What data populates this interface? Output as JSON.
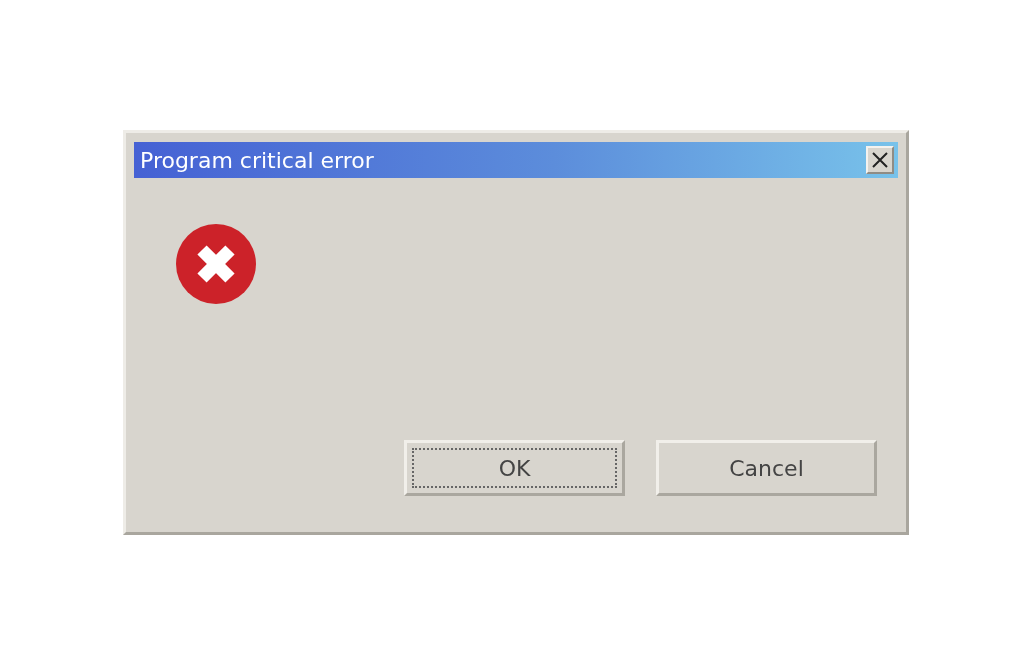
{
  "window": {
    "title": "Program critical error"
  },
  "message_icon": {
    "kind": "error"
  },
  "buttons": [
    {
      "label": "OK",
      "focused": true
    },
    {
      "label": "Cancel",
      "focused": false
    }
  ]
}
